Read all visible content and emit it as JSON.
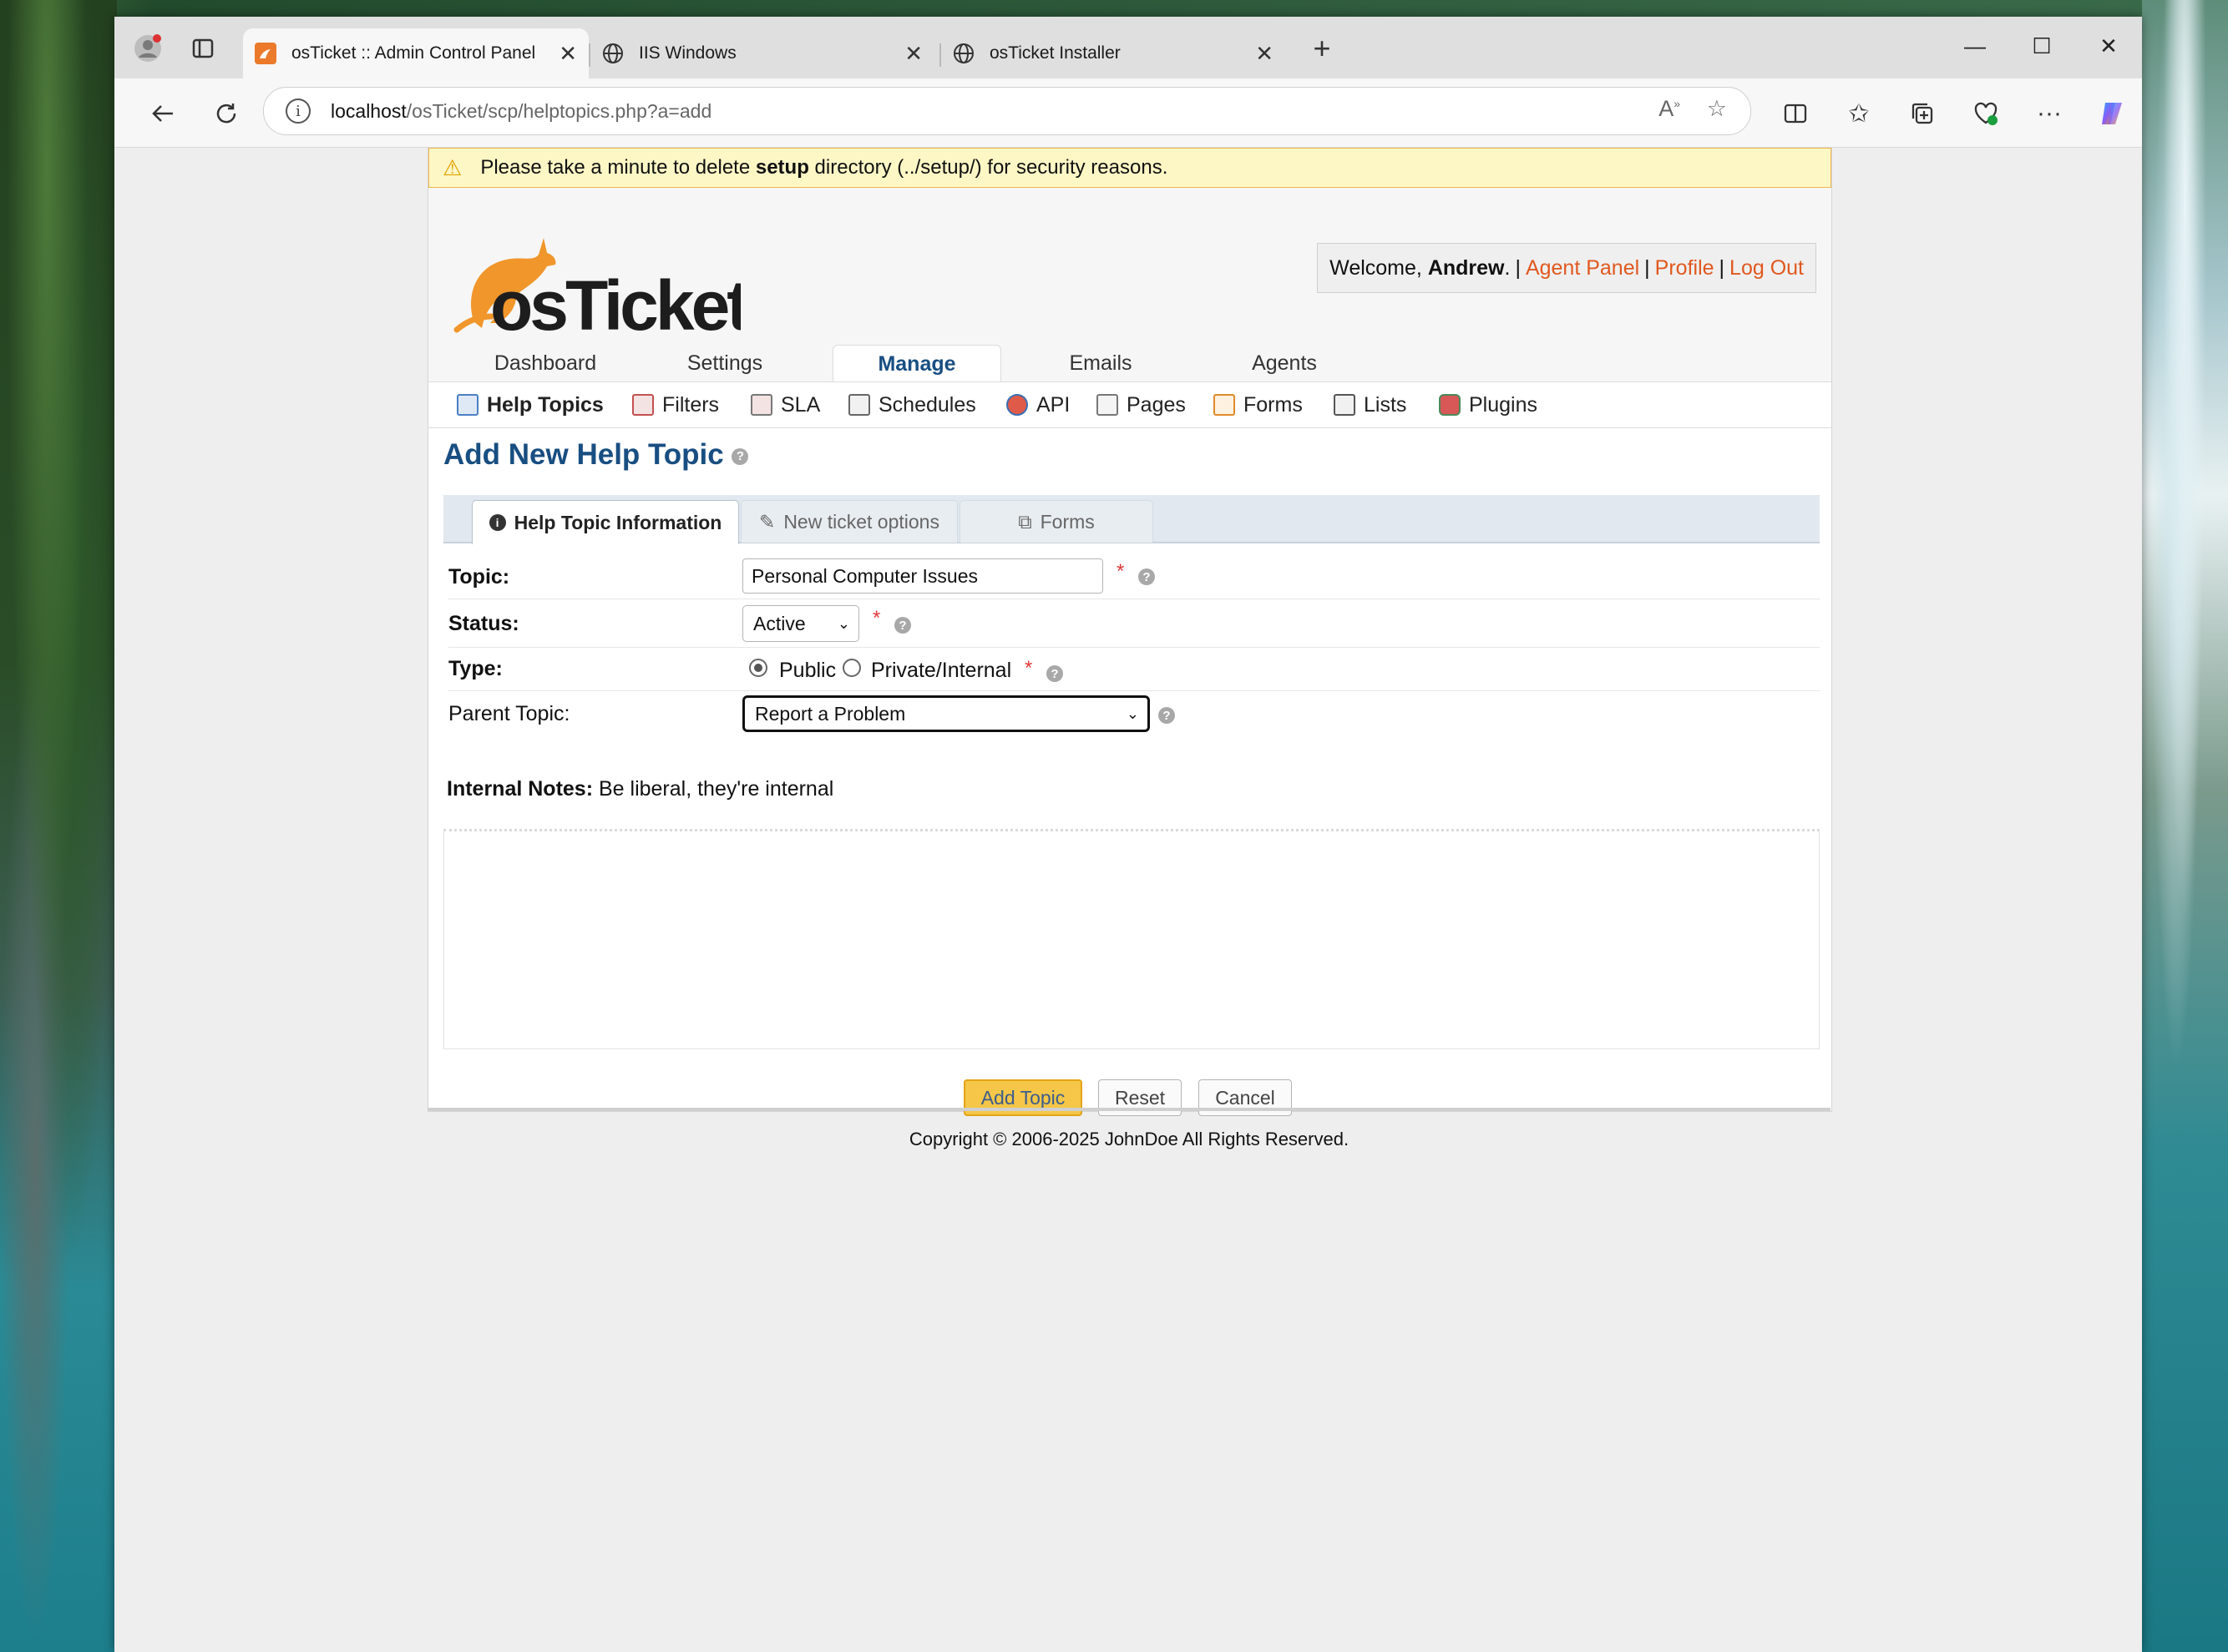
{
  "browser": {
    "tabs": [
      {
        "title": "osTicket :: Admin Control Panel",
        "active": true
      },
      {
        "title": "IIS Windows",
        "active": false
      },
      {
        "title": "osTicket Installer",
        "active": false
      }
    ],
    "address": {
      "host": "localhost",
      "path": "/osTicket/scp/helptopics.php?a=add"
    }
  },
  "warning": {
    "prefix": "Please take a minute to delete ",
    "strong": "setup",
    "suffix": " directory (../setup/) for security reasons."
  },
  "header": {
    "welcome_prefix": "Welcome, ",
    "user": "Andrew",
    "welcome_suffix": ".",
    "links": [
      "Agent Panel",
      "Profile",
      "Log Out"
    ],
    "sep": "|"
  },
  "nav": {
    "tabs": [
      "Dashboard",
      "Settings",
      "Manage",
      "Emails",
      "Agents"
    ],
    "active": "Manage"
  },
  "subnav": [
    "Help Topics",
    "Filters",
    "SLA",
    "Schedules",
    "API",
    "Pages",
    "Forms",
    "Lists",
    "Plugins"
  ],
  "form": {
    "title": "Add New Help Topic",
    "tabs": [
      "Help Topic Information",
      "New ticket options",
      "Forms"
    ],
    "topic_label": "Topic:",
    "topic_value": "Personal Computer Issues",
    "status_label": "Status:",
    "status_value": "Active",
    "type_label": "Type:",
    "type_public": "Public",
    "type_private": "Private/Internal",
    "parent_label": "Parent Topic:",
    "parent_value": "Report a Problem",
    "notes_label": "Internal Notes:",
    "notes_hint": "Be liberal, they're internal",
    "required_mark": "*",
    "help_mark": "?"
  },
  "buttons": {
    "add": "Add Topic",
    "reset": "Reset",
    "cancel": "Cancel"
  },
  "footer": "Copyright © 2006-2025 JohnDoe All Rights Reserved.",
  "colors": {
    "accent": "#184e81",
    "link": "#e0581f",
    "primary_button": "#f5c648",
    "warning_bg": "#fdf7c6"
  }
}
